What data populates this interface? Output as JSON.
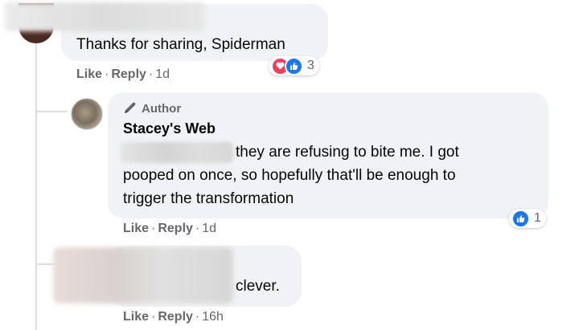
{
  "comments": [
    {
      "text": "Thanks for sharing, Spiderman",
      "actions": {
        "like": "Like",
        "reply": "Reply",
        "time": "1d"
      },
      "reactions": {
        "icons": [
          "love-icon",
          "like-icon"
        ],
        "count": "3"
      }
    },
    {
      "badge": "Author",
      "name": "Stacey's Web",
      "lines": [
        "they are refusing to bite me. I got",
        "pooped on once, so hopefully that'll be enough to",
        "trigger the transformation"
      ],
      "actions": {
        "like": "Like",
        "reply": "Reply",
        "time": "1d"
      },
      "reactions": {
        "icons": [
          "like-icon"
        ],
        "count": "1"
      }
    },
    {
      "text": "clever.",
      "actions": {
        "like": "Like",
        "reply": "Reply",
        "time": "16h"
      }
    }
  ],
  "separator": "·",
  "colors": {
    "bubble": "#f0f2f5",
    "meta_text": "#65676b",
    "like_blue": "#1877f2",
    "love_red": "#f33e58",
    "thread_line": "#dadde1"
  }
}
